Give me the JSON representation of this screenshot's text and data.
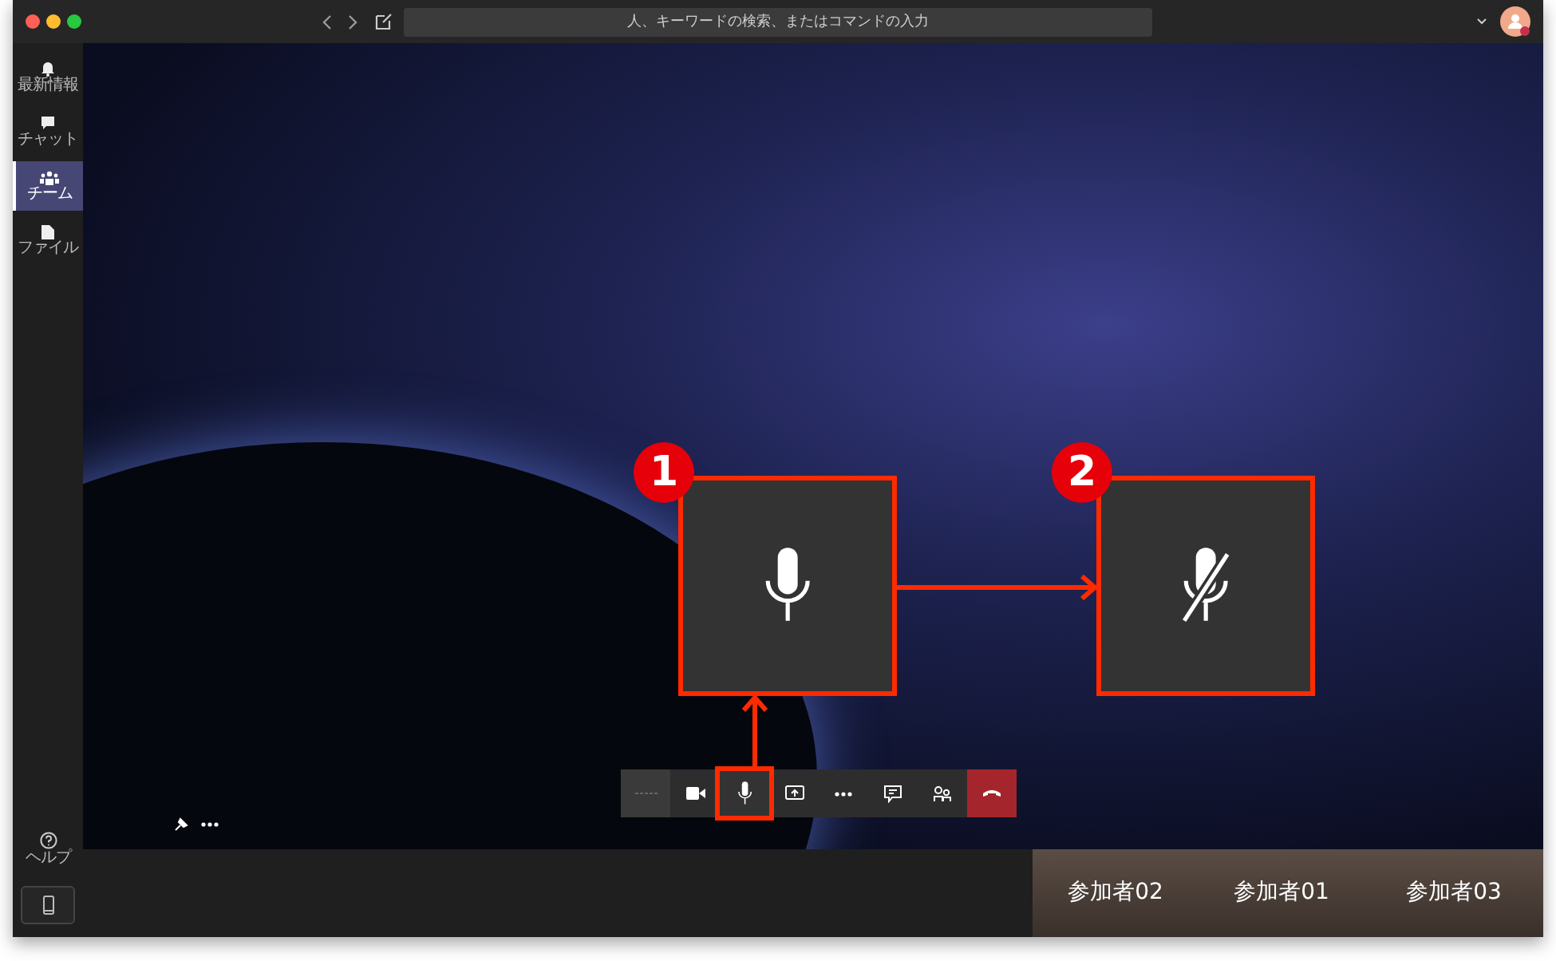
{
  "title_bar": {
    "search_placeholder": "人、キーワードの検索、またはコマンドの入力"
  },
  "rail": {
    "items": [
      {
        "label": "最新情報",
        "kind": "bell",
        "selected": false
      },
      {
        "label": "チャット",
        "kind": "chat",
        "selected": false
      },
      {
        "label": "チーム",
        "kind": "team",
        "selected": true
      },
      {
        "label": "ファイル",
        "kind": "file",
        "selected": false
      }
    ],
    "help": {
      "label": "ヘルプ"
    }
  },
  "call_controls": [
    {
      "kind": "timer",
      "highlighted": false
    },
    {
      "kind": "camera",
      "highlighted": false
    },
    {
      "kind": "mic",
      "highlighted": true
    },
    {
      "kind": "share",
      "highlighted": false
    },
    {
      "kind": "more",
      "highlighted": false
    },
    {
      "kind": "chat",
      "highlighted": false
    },
    {
      "kind": "participants",
      "highlighted": false
    },
    {
      "kind": "hangup",
      "highlighted": false
    }
  ],
  "annotations": [
    {
      "number": "1",
      "muted": false
    },
    {
      "number": "2",
      "muted": true
    }
  ],
  "participants": [
    {
      "name": "参加者02"
    },
    {
      "name": "参加者01"
    },
    {
      "name": "参加者03"
    }
  ]
}
